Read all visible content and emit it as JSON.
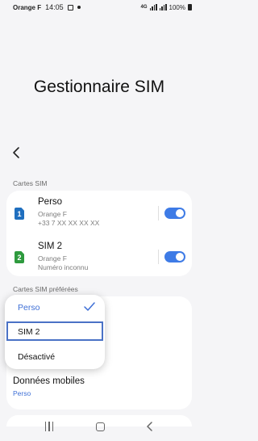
{
  "status_bar": {
    "carrier": "Orange F",
    "time": "14:05",
    "network": "4G",
    "battery": "100%"
  },
  "page": {
    "title": "Gestionnaire SIM"
  },
  "sections": {
    "sim_cards_label": "Cartes SIM",
    "preferred_label": "Cartes SIM préférées"
  },
  "sims": [
    {
      "slot": "1",
      "name": "Perso",
      "carrier": "Orange F",
      "number": "+33 7 XX XX XX XX",
      "enabled": true,
      "color": "#1f6fbf"
    },
    {
      "slot": "2",
      "name": "SIM 2",
      "carrier": "Orange F",
      "number": "Numéro inconnu",
      "enabled": true,
      "color": "#2e9a3e"
    }
  ],
  "dropdown": {
    "options": [
      "Perso",
      "SIM 2",
      "Désactivé"
    ],
    "selected": "Perso",
    "highlighted": "SIM 2"
  },
  "mobile_data": {
    "label": "Données mobiles",
    "value": "Perso"
  },
  "colors": {
    "accent": "#3e7be6",
    "selected_text": "#3e6fd6",
    "background": "#f5f5f7"
  }
}
